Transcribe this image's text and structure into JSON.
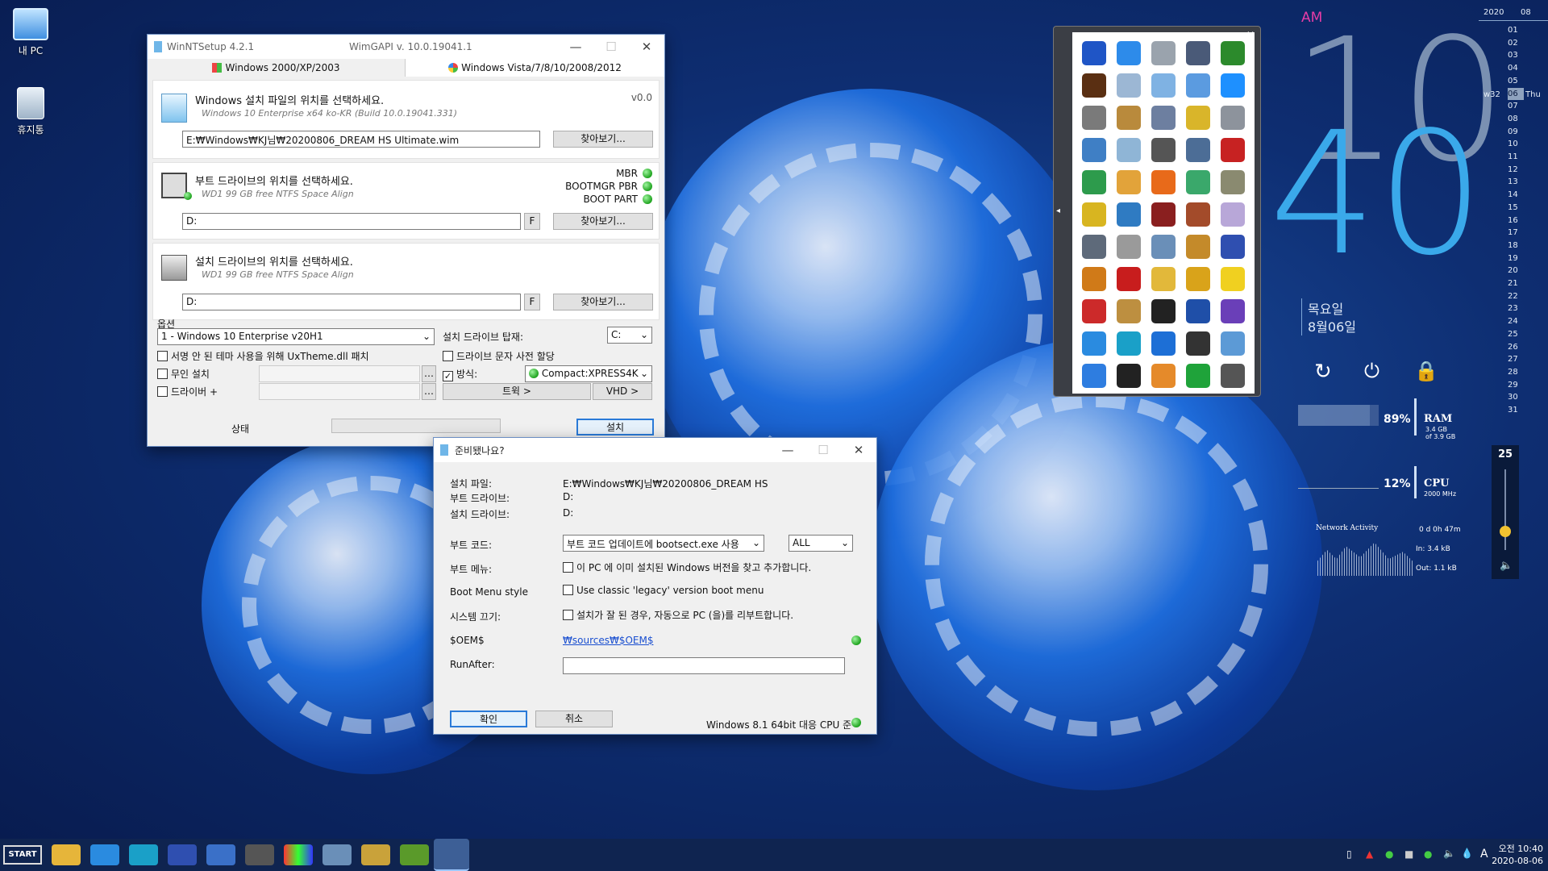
{
  "desktop": {
    "icons": [
      {
        "label": "내 PC"
      },
      {
        "label": "휴지통"
      }
    ]
  },
  "winntsetup": {
    "title": "WinNTSetup 4.2.1",
    "wimgapi": "WimGAPI v. 10.0.19041.1",
    "tab_xp": "Windows 2000/XP/2003",
    "tab_vista": "Windows Vista/7/8/10/2008/2012",
    "version": "v0.0",
    "sec1_title": "Windows 설치 파일의 위치를 선택하세요.",
    "sec1_sub": "Windows 10 Enterprise  x64 ko-KR (Build 10.0.19041.331)",
    "sec1_path": "E:₩Windows₩KJ님₩20200806_DREAM HS Ultimate.wim",
    "browse": "찾아보기...",
    "sec2_title": "부트 드라이브의 위치를 선택하세요.",
    "sec2_sub": "WD1 99 GB free NTFS Space Align",
    "sec2_path": "D:",
    "mbr": "MBR",
    "bootmgr": "BOOTMGR PBR",
    "bootpart": "BOOT PART",
    "sec3_title": "설치 드라이브의 위치를 선택하세요.",
    "sec3_sub": "WD1 99 GB free NTFS Space Align",
    "sec3_path": "D:",
    "f_btn": "F",
    "options_label": "옵션",
    "edition": "1 - Windows 10 Enterprise v20H1",
    "mount_label": "설치 드라이브 탑재:",
    "mount_value": "C:",
    "opt_uxtheme": "서명 안 된 테마 사용을 위해 UxTheme.dll 패치",
    "opt_letter": "드라이브 문자 사전 할당",
    "opt_unattend": "무인 설치",
    "opt_mode": "방식:",
    "mode_value": "Compact:XPRESS4K",
    "opt_driver": "드라이버 +",
    "tweak": "트윅 >",
    "vhd": "VHD >",
    "status": "상태",
    "install": "설치"
  },
  "dialog": {
    "title": "준비됐나요?",
    "l_file": "설치 파일:",
    "v_file": "E:₩Windows₩KJ님₩20200806_DREAM HS",
    "l_boot": "부트 드라이브:",
    "v_boot": "D:",
    "l_inst": "설치 드라이브:",
    "v_inst": "D:",
    "l_bootcode": "부트 코드:",
    "v_bootcode": "부트 코드 업데이트에 bootsect.exe 사용",
    "v_all": "ALL",
    "l_bootmenu": "부트 메뉴:",
    "v_bootmenu": "이 PC 에 이미 설치된 Windows 버전을 찾고 추가합니다.",
    "l_style": "Boot Menu style",
    "v_style": "Use classic 'legacy' version boot menu",
    "l_reboot": "시스템 끄기:",
    "v_reboot": "설치가 잘 된 경우, 자동으로 PC (을)를 리부트합니다.",
    "l_oem": "$OEM$",
    "v_oem": "₩sources₩$OEM$",
    "l_runafter": "RunAfter:",
    "ok": "확인",
    "cancel": "취소",
    "cpu_note": "Windows 8.1 64bit 대응 CPU 준"
  },
  "clock": {
    "ampm": "AM",
    "hour": "10",
    "minute": "40",
    "weekday": "목요일",
    "date": "8월06일"
  },
  "calendar": {
    "year": "2020",
    "month": "08",
    "week": "w32",
    "today_name": "Thu",
    "days": [
      "01",
      "02",
      "03",
      "04",
      "05",
      "06",
      "07",
      "08",
      "09",
      "10",
      "11",
      "12",
      "13",
      "14",
      "15",
      "16",
      "17",
      "18",
      "19",
      "20",
      "21",
      "22",
      "23",
      "24",
      "25",
      "26",
      "27",
      "28",
      "29",
      "30",
      "31"
    ]
  },
  "meters": {
    "ram_pct": "89%",
    "ram_label": "RAM",
    "ram_detail": "3.4 GB",
    "ram_detail2": "of 3.9 GB",
    "cpu_pct": "12%",
    "cpu_label": "CPU",
    "cpu_detail": "2000 MHz",
    "net_label": "Network Activity",
    "uptime": "0 d 0h 47m",
    "net_in": "In: 3.4 kB",
    "net_out": "Out: 1.1 kB",
    "volume": "25"
  },
  "taskbar": {
    "start": "START",
    "time": "오전 10:40",
    "date": "2020-08-06",
    "ime": "A"
  }
}
